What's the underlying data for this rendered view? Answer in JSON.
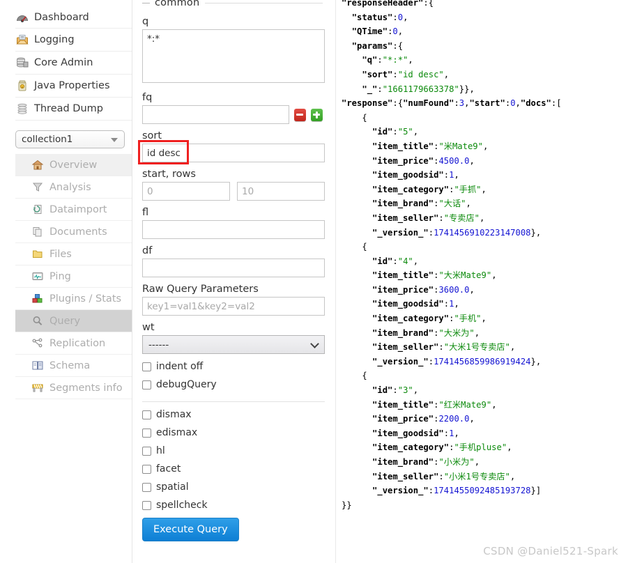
{
  "sidebar": {
    "top_items": [
      {
        "label": "Dashboard",
        "icon": "dashboard-icon"
      },
      {
        "label": "Logging",
        "icon": "logging-icon"
      },
      {
        "label": "Core Admin",
        "icon": "core-admin-icon"
      },
      {
        "label": "Java Properties",
        "icon": "java-properties-icon"
      },
      {
        "label": "Thread Dump",
        "icon": "thread-dump-icon"
      }
    ],
    "collection_selected": "collection1",
    "core_items": [
      {
        "label": "Overview",
        "icon": "home-icon",
        "state": "hover"
      },
      {
        "label": "Analysis",
        "icon": "funnel-icon",
        "state": "normal"
      },
      {
        "label": "Dataimport",
        "icon": "dataimport-icon",
        "state": "normal"
      },
      {
        "label": "Documents",
        "icon": "documents-icon",
        "state": "normal"
      },
      {
        "label": "Files",
        "icon": "folder-icon",
        "state": "normal"
      },
      {
        "label": "Ping",
        "icon": "ping-icon",
        "state": "normal"
      },
      {
        "label": "Plugins / Stats",
        "icon": "plugins-icon",
        "state": "normal"
      },
      {
        "label": "Query",
        "icon": "magnifier-icon",
        "state": "active"
      },
      {
        "label": "Replication",
        "icon": "replication-icon",
        "state": "normal"
      },
      {
        "label": "Schema",
        "icon": "schema-icon",
        "state": "normal"
      },
      {
        "label": "Segments info",
        "icon": "segments-icon",
        "state": "normal"
      }
    ]
  },
  "query_form": {
    "legend": "common",
    "q_label": "q",
    "q_value": "*:*",
    "fq_label": "fq",
    "fq_value": "",
    "sort_label": "sort",
    "sort_value": "id desc",
    "startrows_label": "start, rows",
    "start_placeholder": "0",
    "start_value": "",
    "rows_placeholder": "10",
    "rows_value": "",
    "fl_label": "fl",
    "fl_value": "",
    "df_label": "df",
    "df_value": "",
    "raw_label": "Raw Query Parameters",
    "raw_placeholder": "key1=val1&key2=val2",
    "raw_value": "",
    "wt_label": "wt",
    "wt_value": "------",
    "remove_button": "remove-fq-button",
    "add_button": "add-fq-button",
    "checkboxes_group1": [
      {
        "label": "indent off",
        "checked": false
      },
      {
        "label": "debugQuery",
        "checked": false
      }
    ],
    "checkboxes_group2": [
      {
        "label": "dismax",
        "checked": false
      },
      {
        "label": "edismax",
        "checked": false,
        "bold_prefix": "e"
      },
      {
        "label": "hl",
        "checked": false
      },
      {
        "label": "facet",
        "checked": false
      },
      {
        "label": "spatial",
        "checked": false
      },
      {
        "label": "spellcheck",
        "checked": false
      }
    ],
    "execute_label": "Execute Query"
  },
  "response": {
    "header": {
      "status": 0,
      "QTime": 0,
      "params": {
        "q": "*:*",
        "sort": "id desc",
        "_": "1661179663378"
      }
    },
    "numFound": 3,
    "start": 0,
    "docs": [
      {
        "id": "5",
        "item_title": "米Mate9",
        "item_price": "4500.0",
        "item_goodsid": "1",
        "item_category": "手抓",
        "item_brand": "大话",
        "item_seller": "专卖店",
        "_version_": "1741456910223147008"
      },
      {
        "id": "4",
        "item_title": "大米Mate9",
        "item_price": "3600.0",
        "item_goodsid": "1",
        "item_category": "手机",
        "item_brand": "大米为",
        "item_seller": "大米1号专卖店",
        "_version_": "1741456859986919424"
      },
      {
        "id": "3",
        "item_title": "红米Mate9",
        "item_price": "2200.0",
        "item_goodsid": "1",
        "item_category": "手机pluse",
        "item_brand": "小米为",
        "item_seller": "小米1号专卖店",
        "_version_": "1741455092485193728"
      }
    ]
  },
  "watermark": "CSDN @Daniel521-Spark",
  "colors": {
    "accent_blue": "#0d7fd4",
    "json_string": "#0c8a0c",
    "json_number": "#1414d2",
    "highlight_red": "#ef2020",
    "remove_red": "#c1261c",
    "add_green": "#34a024"
  }
}
